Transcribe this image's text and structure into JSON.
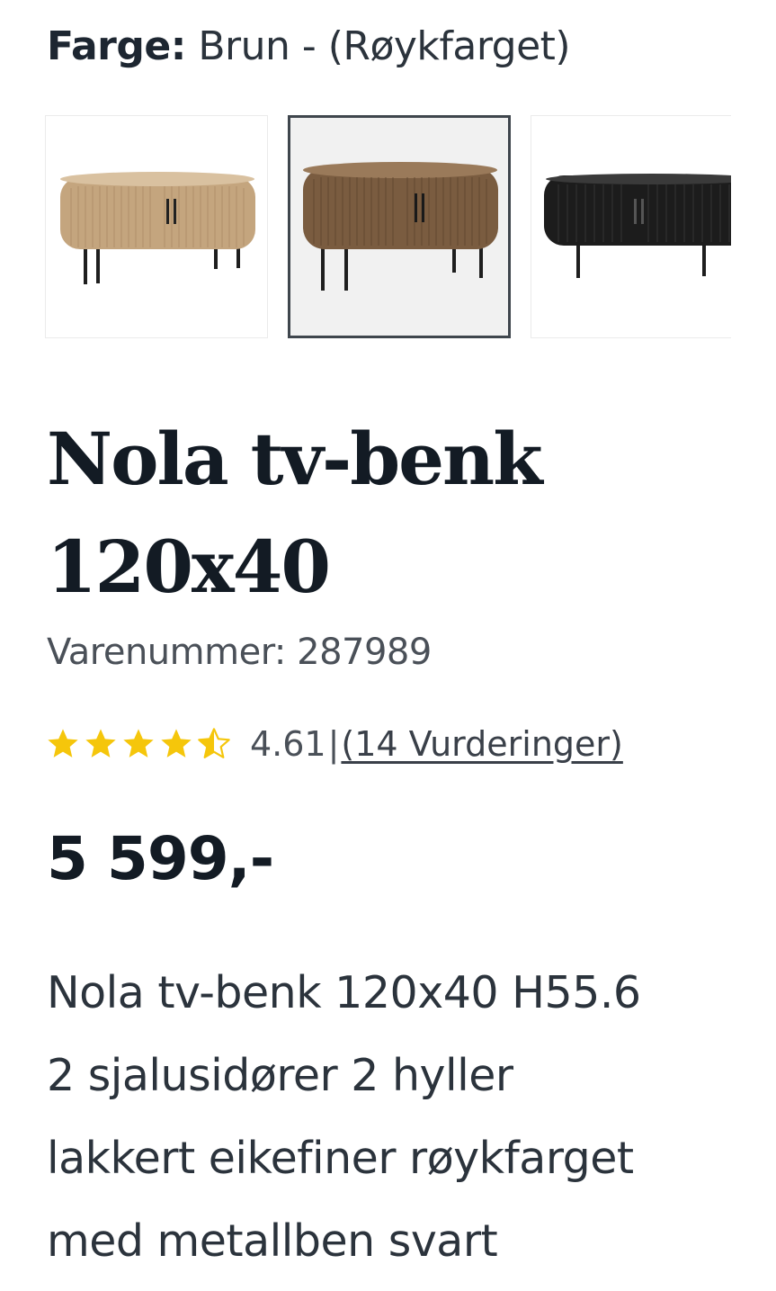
{
  "color_selector": {
    "label": "Farge:",
    "value": "Brun - (Røykfarget)"
  },
  "swatches": [
    {
      "name": "natural-oak",
      "color": "#c4a57e",
      "selected": false
    },
    {
      "name": "smoked-oak",
      "color": "#7a5c40",
      "selected": true
    },
    {
      "name": "black",
      "color": "#1c1c1c",
      "selected": false
    }
  ],
  "product": {
    "title_line1": "Nola tv-benk",
    "title_line2": "120x40",
    "sku": "Varenummer: 287989",
    "rating": {
      "value": 4.61,
      "score_text": "4.61",
      "separator": "|",
      "reviews_link": "(14 Vurderinger)",
      "star_color": "#f5c60b",
      "star_count": 5
    },
    "price": "5 599,-",
    "description": [
      "Nola tv-benk 120x40 H55.6",
      "2 sjalusidører 2 hyller",
      "lakkert eikefiner røykfarget",
      "med metallben svart"
    ]
  }
}
